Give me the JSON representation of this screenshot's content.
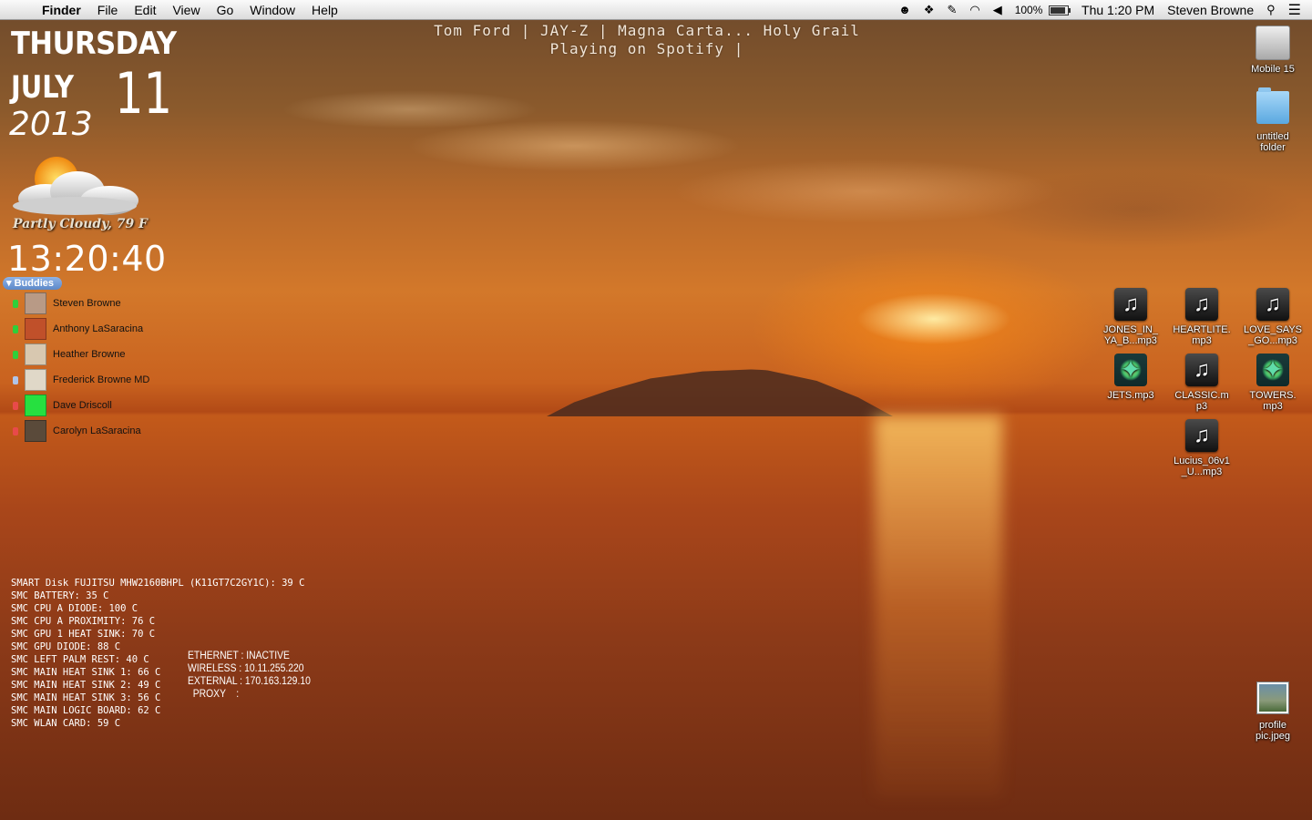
{
  "menubar": {
    "app_name": "Finder",
    "menus": [
      "File",
      "Edit",
      "View",
      "Go",
      "Window",
      "Help"
    ],
    "battery": "100%",
    "clock": "Thu 1:20 PM",
    "user": "Steven Browne",
    "icons": [
      "apple-icon",
      "robot-icon",
      "dropbox-icon",
      "wrench-icon",
      "wifi-icon",
      "volume-icon",
      "battery-icon",
      "spotlight-icon",
      "notification-list-icon"
    ]
  },
  "now_playing": {
    "line1": "Tom Ford | JAY-Z | Magna Carta... Holy Grail",
    "line2": "Playing on Spotify |"
  },
  "date": {
    "weekday": "THURSDAY",
    "month": "JULY",
    "day": "11",
    "year": "2013"
  },
  "weather": {
    "text": "Partly Cloudy, 79 F"
  },
  "clock": "13:20:40",
  "buddies": {
    "header": "Buddies",
    "items": [
      {
        "name": "Steven Browne",
        "status": "#2fcf3a",
        "avatar": "#b89a86"
      },
      {
        "name": "Anthony LaSaracina",
        "status": "#2fcf3a",
        "avatar": "#c0502a"
      },
      {
        "name": "Heather Browne",
        "status": "#2fcf3a",
        "avatar": "#d8c8b0"
      },
      {
        "name": "Frederick Browne MD",
        "status": "#b0c4e8",
        "avatar": "#e0d8c8"
      },
      {
        "name": "Dave Driscoll",
        "status": "#e84a4a",
        "avatar": "#26e040"
      },
      {
        "name": "Carolyn LaSaracina",
        "status": "#e84a4a",
        "avatar": "#5a4a3a"
      }
    ]
  },
  "stats": [
    "SMART Disk FUJITSU MHW2160BHPL (K11GT7C2GY1C): 39 C",
    "SMC BATTERY: 35 C",
    "SMC CPU A DIODE: 100 C",
    "SMC CPU A PROXIMITY: 76 C",
    "SMC GPU 1 HEAT SINK: 70 C",
    "SMC GPU DIODE: 88 C",
    "SMC LEFT PALM REST: 40 C",
    "SMC MAIN HEAT SINK 1: 66 C",
    "SMC MAIN HEAT SINK 2: 49 C",
    "SMC MAIN HEAT SINK 3: 56 C",
    "SMC MAIN LOGIC BOARD: 62 C",
    "SMC WLAN CARD: 59 C"
  ],
  "network": [
    "ETHERNET : INACTIVE",
    "WIRELESS : 10.11.255.220",
    "EXTERNAL : 170.163.129.10",
    "  PROXY    :"
  ],
  "desktop_icons": {
    "mobile": "Mobile 15",
    "folder": "untitled folder",
    "jones": "JONES_IN_YA_B...mp3",
    "heartlite": "HEARTLITE.mp3",
    "love": "LOVE_SAYS_GO...mp3",
    "jets": "JETS.mp3",
    "classic": "CLASSIC.mp3",
    "towers": "TOWERS.mp3",
    "lucius": "Lucius_06v1_U...mp3",
    "profile": "profile pic.jpeg"
  }
}
